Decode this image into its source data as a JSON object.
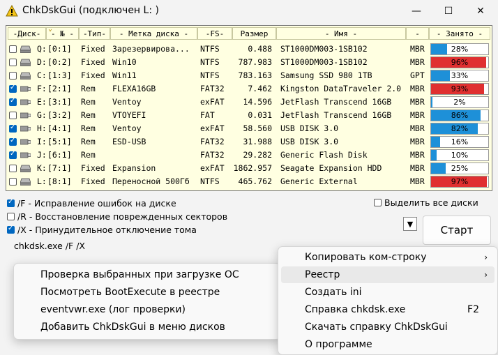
{
  "window": {
    "title": "ChkDskGui (подключен L: )",
    "min": "—",
    "max": "☐",
    "close": "✕"
  },
  "table": {
    "headers": [
      "-Диск-",
      "- № -",
      "-Тип-",
      "- Метка диска -",
      "-FS-",
      "Размер",
      "- Имя -",
      "-",
      "- Занято -"
    ],
    "rows": [
      {
        "checked": false,
        "icon": "hdd-icon",
        "disk": "Q:",
        "num": "[0:1]",
        "type": "Fixed",
        "label": "Зарезервирова...",
        "fs": "NTFS",
        "size": "0.488",
        "name": "ST1000DM003-1SB102",
        "pt": "MBR",
        "used": 28,
        "used_label": "28%",
        "color": "#1e90d8"
      },
      {
        "checked": false,
        "icon": "hdd-icon",
        "disk": "D:",
        "num": "[0:2]",
        "type": "Fixed",
        "label": "Win10",
        "fs": "NTFS",
        "size": "787.983",
        "name": "ST1000DM003-1SB102",
        "pt": "MBR",
        "used": 96,
        "used_label": "96%",
        "color": "#e03030"
      },
      {
        "checked": false,
        "icon": "hdd-icon",
        "disk": "C:",
        "num": "[1:3]",
        "type": "Fixed",
        "label": "Win11",
        "fs": "NTFS",
        "size": "783.163",
        "name": "Samsung SSD 980 1TB",
        "pt": "GPT",
        "used": 33,
        "used_label": "33%",
        "color": "#1e90d8"
      },
      {
        "checked": true,
        "icon": "usb-icon",
        "disk": "F:",
        "num": "[2:1]",
        "type": "Rem",
        "label": "FLEXA16GB",
        "fs": "FAT32",
        "size": "7.462",
        "name": "Kingston DataTraveler 2.0",
        "pt": "MBR",
        "used": 93,
        "used_label": "93%",
        "color": "#e03030"
      },
      {
        "checked": true,
        "icon": "usb-icon",
        "disk": "E:",
        "num": "[3:1]",
        "type": "Rem",
        "label": "Ventoy",
        "fs": "exFAT",
        "size": "14.596",
        "name": "JetFlash Transcend 16GB",
        "pt": "MBR",
        "used": 2,
        "used_label": "2%",
        "color": "#1e90d8"
      },
      {
        "checked": false,
        "icon": "usb-icon",
        "disk": "G:",
        "num": "[3:2]",
        "type": "Rem",
        "label": "VTOYEFI",
        "fs": "FAT",
        "size": "0.031",
        "name": "JetFlash Transcend 16GB",
        "pt": "MBR",
        "used": 86,
        "used_label": "86%",
        "color": "#1e90d8"
      },
      {
        "checked": true,
        "icon": "usb-icon",
        "disk": "H:",
        "num": "[4:1]",
        "type": "Rem",
        "label": "Ventoy",
        "fs": "exFAT",
        "size": "58.560",
        "name": " USB DISK 3.0",
        "pt": "MBR",
        "used": 82,
        "used_label": "82%",
        "color": "#1e90d8"
      },
      {
        "checked": true,
        "icon": "usb-icon",
        "disk": "I:",
        "num": "[5:1]",
        "type": "Rem",
        "label": "ESD-USB",
        "fs": "FAT32",
        "size": "31.988",
        "name": " USB DISK 3.0",
        "pt": "MBR",
        "used": 16,
        "used_label": "16%",
        "color": "#1e90d8"
      },
      {
        "checked": true,
        "icon": "usb-icon",
        "disk": "J:",
        "num": "[6:1]",
        "type": "Rem",
        "label": "",
        "fs": "FAT32",
        "size": "29.282",
        "name": "Generic Flash Disk",
        "pt": "MBR",
        "used": 10,
        "used_label": "10%",
        "color": "#1e90d8"
      },
      {
        "checked": false,
        "icon": "hdd-icon",
        "disk": "K:",
        "num": "[7:1]",
        "type": "Fixed",
        "label": "Expansion",
        "fs": "exFAT",
        "size": "1862.957",
        "name": "Seagate Expansion HDD",
        "pt": "MBR",
        "used": 25,
        "used_label": "25%",
        "color": "#1e90d8"
      },
      {
        "checked": false,
        "icon": "hdd-icon",
        "disk": "L:",
        "num": "[8:1]",
        "type": "Fixed",
        "label": "Переносной 500Гб",
        "fs": "NTFS",
        "size": "465.762",
        "name": "Generic External",
        "pt": "MBR",
        "used": 97,
        "used_label": "97%",
        "color": "#e03030"
      }
    ]
  },
  "options": {
    "fix": "/F - Исправление ошибок на диске",
    "recover": "/R - Восстановление поврежденных секторов",
    "force": "/X - Принудительное отключение тома",
    "select_all": "Выделить все диски",
    "fix_checked": true,
    "recover_checked": false,
    "force_checked": true,
    "select_all_checked": false
  },
  "command": "chkdsk.exe  /F /X",
  "start_label": "Старт",
  "arrow_glyph": "▼",
  "main_menu": [
    {
      "label": "Копировать ком-строку",
      "shortcut": "",
      "submenu": true
    },
    {
      "label": "Реестр",
      "shortcut": "",
      "submenu": true
    },
    {
      "label": "Создать ini",
      "shortcut": "",
      "submenu": false
    },
    {
      "label": "Справка chkdsk.exe",
      "shortcut": "F2",
      "submenu": false
    },
    {
      "label": "Скачать справку ChkDskGui",
      "shortcut": "",
      "submenu": false
    },
    {
      "label": "О программе",
      "shortcut": "",
      "submenu": false
    }
  ],
  "sub_menu": [
    {
      "label": "Проверка выбранных при загрузке ОС"
    },
    {
      "label": "Посмотреть BootExecute в реестре"
    },
    {
      "label": "eventvwr.exe (лог проверки)"
    },
    {
      "label": "Добавить ChkDskGui в меню дисков"
    }
  ],
  "submenu_arrow": "›"
}
